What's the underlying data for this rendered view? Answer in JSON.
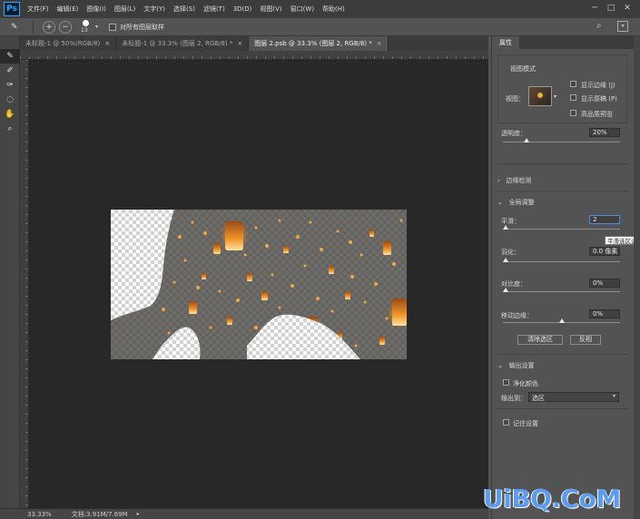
{
  "app": {
    "logo": "Ps"
  },
  "menu": [
    "文件(F)",
    "编辑(E)",
    "图像(I)",
    "图层(L)",
    "文字(Y)",
    "选择(S)",
    "滤镜(T)",
    "3D(D)",
    "视图(V)",
    "窗口(W)",
    "帮助(H)"
  ],
  "options": {
    "brush_size": "13",
    "sample_all_layers": "对所有图层取样"
  },
  "tabs": [
    {
      "label": "未标题-1 @ 50%(RGB/8)",
      "active": false
    },
    {
      "label": "未标题-1 @ 33.3% (图层 2, RGB/8) *",
      "active": false
    },
    {
      "label": "图层 2.psb @ 33.3% (图层 2, RGB/8) *",
      "active": true
    }
  ],
  "tools": [
    "quick-selection-icon",
    "refine-radius-icon",
    "erase-refinements-icon",
    "lasso-icon",
    "hand-icon",
    "zoom-icon"
  ],
  "status": {
    "zoom": "33.33%",
    "doc_info": "文档:3.91M/7.69M"
  },
  "panel": {
    "title": "属性",
    "view_mode": {
      "section": "视图模式",
      "view_label": "视图：",
      "show_edge": "显示边缘 (J)",
      "show_original": "显示原稿 (P)",
      "high_quality": "高品质预览",
      "opacity_label": "透明度：",
      "opacity_value": "20%",
      "opacity_level": 0.2
    },
    "edge_detection": {
      "section": "边缘检测"
    },
    "global_refinements": {
      "section": "全局调整",
      "smooth_label": "平滑：",
      "smooth_value": "2",
      "smooth_tooltip": "平滑选区边缘",
      "feather_label": "羽化：",
      "feather_value": "0.0 像素",
      "contrast_label": "对比度：",
      "contrast_value": "0%",
      "shift_edge_label": "移动边缘：",
      "shift_edge_value": "0%",
      "clear_selection": "清除选区",
      "invert": "反相"
    },
    "output": {
      "section": "输出设置",
      "decontaminate": "净化颜色",
      "output_to_label": "输出到：",
      "output_to_value": "选区",
      "remember": "记住设置"
    }
  },
  "watermark": "UiBQ.CoM"
}
